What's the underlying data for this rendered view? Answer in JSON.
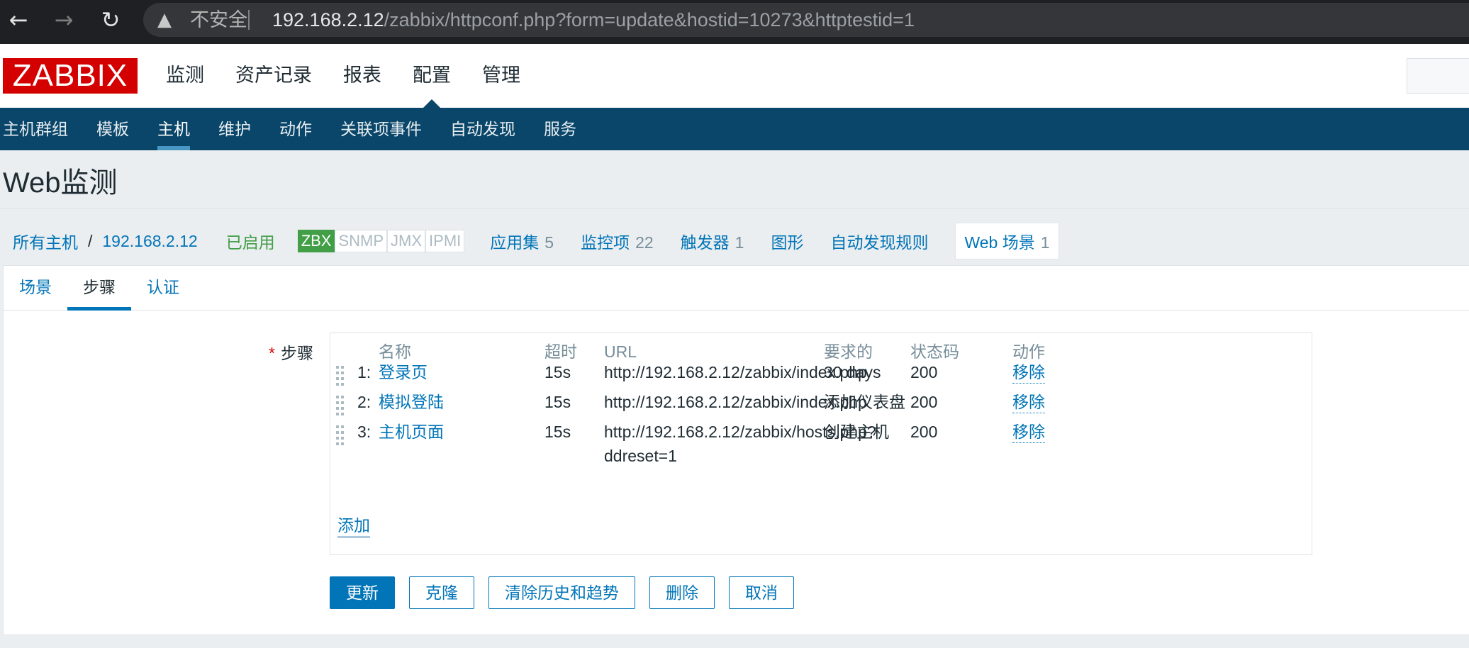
{
  "browser": {
    "insecure_label": "不安全",
    "url_host": "192.168.2.12",
    "url_path": "/zabbix/httpconf.php?form=update&hostid=10273&httptestid=1"
  },
  "header": {
    "logo_text": "ZABBIX",
    "main_menu": [
      "监测",
      "资产记录",
      "报表",
      "配置",
      "管理"
    ],
    "main_menu_selected": "配置"
  },
  "sub_menu": {
    "items": [
      "主机群组",
      "模板",
      "主机",
      "维护",
      "动作",
      "关联项事件",
      "自动发现",
      "服务"
    ],
    "selected": "主机"
  },
  "page": {
    "title": "Web监测"
  },
  "breadcrumbs": {
    "all_hosts": "所有主机",
    "separator": "/",
    "host": "192.168.2.12",
    "status": "已启用",
    "availability": [
      "ZBX",
      "SNMP",
      "JMX",
      "IPMI"
    ],
    "links": [
      {
        "label": "应用集",
        "count": "5"
      },
      {
        "label": "监控项",
        "count": "22"
      },
      {
        "label": "触发器",
        "count": "1"
      },
      {
        "label": "图形",
        "count": ""
      },
      {
        "label": "自动发现规则",
        "count": ""
      },
      {
        "label": "Web 场景",
        "count": "1"
      }
    ]
  },
  "colors": {
    "brand_red": "#d40000",
    "nav_dark": "#0a466a",
    "link_blue": "#0275b8",
    "enabled_green": "#429e47"
  },
  "tabs": [
    "场景",
    "步骤",
    "认证"
  ],
  "active_tab": "步骤",
  "steps": {
    "label": "步骤",
    "required_marker": "*",
    "columns": [
      "名称",
      "超时",
      "URL",
      "要求的",
      "状态码",
      "动作"
    ],
    "rows": [
      {
        "num": "1:",
        "name": "登录页",
        "timeout": "15s",
        "url": "http://192.168.2.12/zabbix/index.php",
        "url2": "",
        "required": "30 days",
        "status": "200",
        "action": "移除"
      },
      {
        "num": "2:",
        "name": "模拟登陆",
        "timeout": "15s",
        "url": "http://192.168.2.12/zabbix/index.php",
        "url2": "",
        "required": "添加仪表盘",
        "status": "200",
        "action": "移除"
      },
      {
        "num": "3:",
        "name": "主机页面",
        "timeout": "15s",
        "url": "http://192.168.2.12/zabbix/hosts.php?",
        "url2": "ddreset=1",
        "required": "创建主机",
        "status": "200",
        "action": "移除"
      }
    ],
    "add_label": "添加"
  },
  "buttons": {
    "update": "更新",
    "clone": "克隆",
    "clear_history": "清除历史和趋势",
    "delete": "删除",
    "cancel": "取消"
  }
}
